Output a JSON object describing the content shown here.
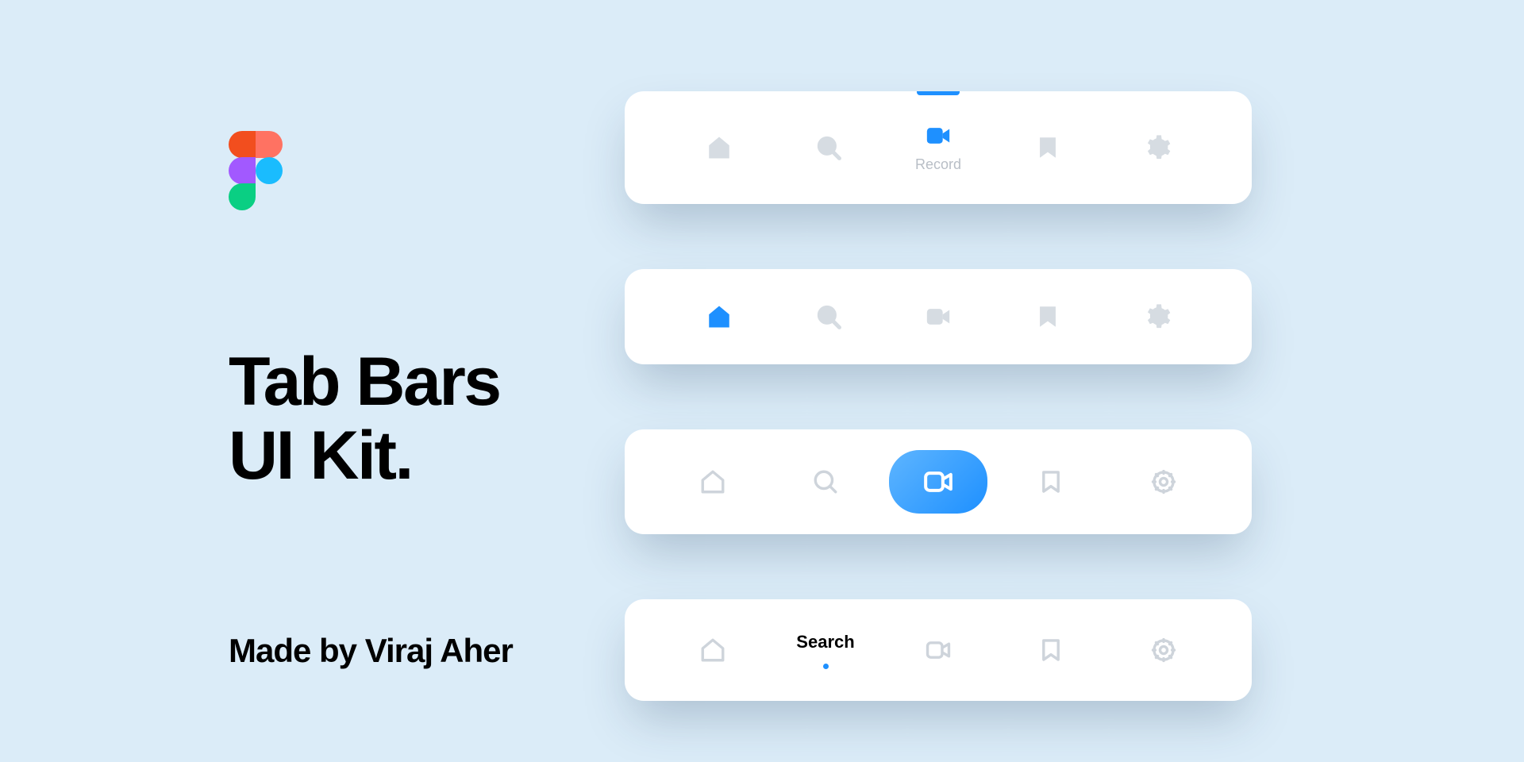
{
  "title_line1": "Tab Bars",
  "title_line2": "UI Kit.",
  "subtitle": "Made by Viraj Aher",
  "colors": {
    "accent": "#1e90ff",
    "background": "#dbecf8",
    "muted": "#d6dce2",
    "muted_stroke": "#ced4db"
  },
  "tabbars": [
    {
      "style": "top-indicator-with-label",
      "active_index": 2,
      "items": [
        {
          "icon": "home",
          "label": "Home"
        },
        {
          "icon": "search",
          "label": "Search"
        },
        {
          "icon": "video",
          "label": "Record"
        },
        {
          "icon": "bookmark",
          "label": "Bookmark"
        },
        {
          "icon": "gear",
          "label": "Settings"
        }
      ]
    },
    {
      "style": "icon-only-filled-active",
      "active_index": 0,
      "items": [
        {
          "icon": "home"
        },
        {
          "icon": "search"
        },
        {
          "icon": "video"
        },
        {
          "icon": "bookmark"
        },
        {
          "icon": "gear"
        }
      ]
    },
    {
      "style": "pill-center",
      "active_index": 2,
      "items": [
        {
          "icon": "home"
        },
        {
          "icon": "search"
        },
        {
          "icon": "video"
        },
        {
          "icon": "bookmark"
        },
        {
          "icon": "gear"
        }
      ]
    },
    {
      "style": "text-active-with-dot",
      "active_index": 1,
      "items": [
        {
          "icon": "home",
          "label": "Home"
        },
        {
          "icon": "search",
          "label": "Search"
        },
        {
          "icon": "video",
          "label": "Record"
        },
        {
          "icon": "bookmark",
          "label": "Bookmark"
        },
        {
          "icon": "gear",
          "label": "Settings"
        }
      ]
    }
  ]
}
